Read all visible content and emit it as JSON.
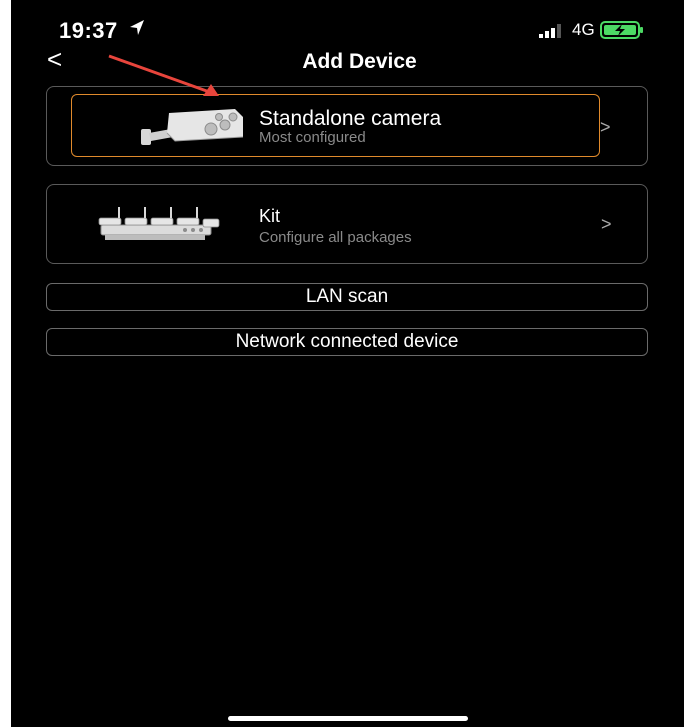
{
  "status_bar": {
    "time": "19:37",
    "network": "4G",
    "icons": [
      "location-arrow-icon",
      "signal-bars-icon",
      "battery-charging-icon"
    ],
    "battery_color": "#4cd964"
  },
  "nav": {
    "back_label": "<",
    "title": "Add Device"
  },
  "options": [
    {
      "title": "Standalone camera",
      "subtitle": "Most configured",
      "chevron": ">",
      "icon": "camera-image",
      "highlight_color": "#e08a2c"
    },
    {
      "title": "Kit",
      "subtitle": "Configure all packages",
      "chevron": ">",
      "icon": "camera-kit-image"
    }
  ],
  "buttons": {
    "lan_scan": "LAN scan",
    "network_device": "Network connected device"
  },
  "annotation": {
    "arrow_color": "#e8453c"
  }
}
